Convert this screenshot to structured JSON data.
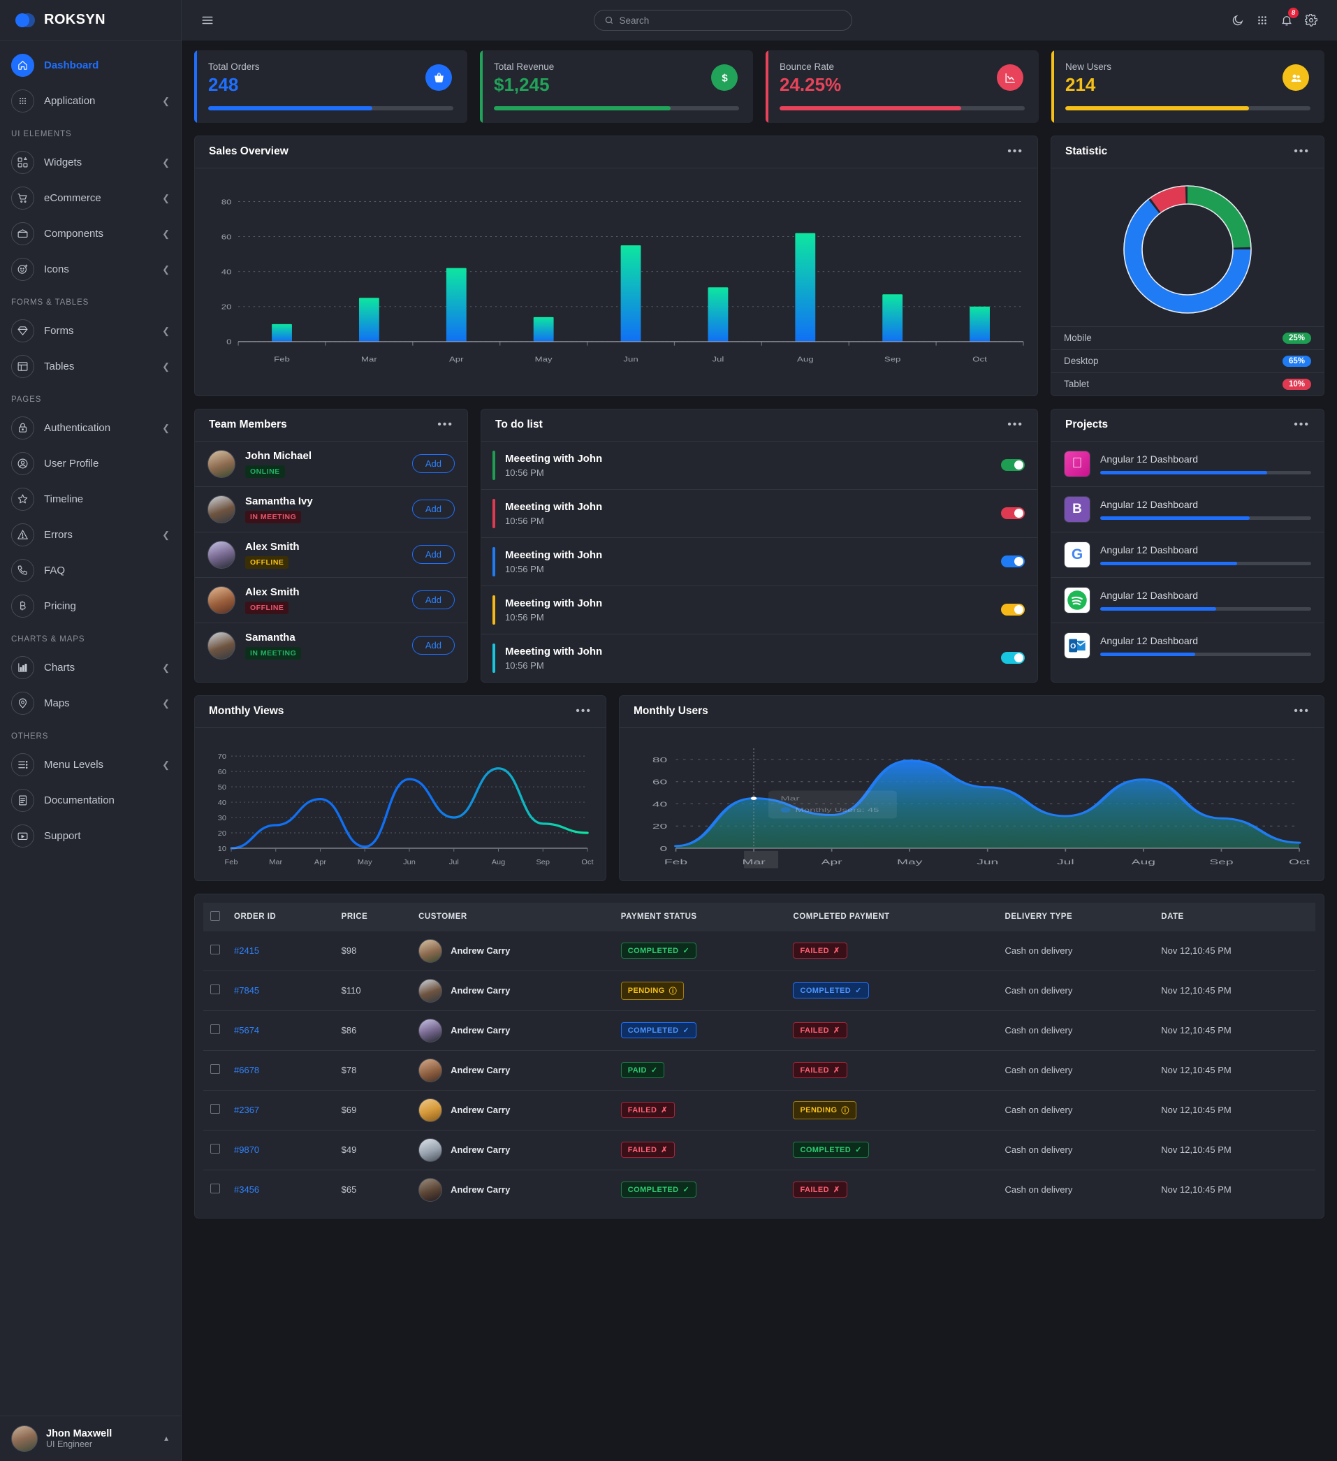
{
  "brand": {
    "name": "ROKSYN"
  },
  "topbar": {
    "menu_icon": "hamburger-icon",
    "search_placeholder": "Search",
    "search_value": "",
    "dark_mode_icon": "moon-icon",
    "apps_icon": "grid-apps-icon",
    "notifications_icon": "bell-icon",
    "notifications_count": "8",
    "settings_icon": "gear-icon"
  },
  "sidebar": {
    "groups": [
      {
        "label": "",
        "items": [
          {
            "label": "Dashboard",
            "icon": "home-icon",
            "active": true,
            "chevron": false
          },
          {
            "label": "Application",
            "icon": "grid-dots-icon",
            "active": false,
            "chevron": true
          }
        ]
      },
      {
        "label": "UI ELEMENTS",
        "items": [
          {
            "label": "Widgets",
            "icon": "widgets-icon",
            "active": false,
            "chevron": true
          },
          {
            "label": "eCommerce",
            "icon": "cart-icon",
            "active": false,
            "chevron": true
          },
          {
            "label": "Components",
            "icon": "components-icon",
            "active": false,
            "chevron": true
          },
          {
            "label": "Icons",
            "icon": "smiley-plus-icon",
            "active": false,
            "chevron": true
          }
        ]
      },
      {
        "label": "FORMS & TABLES",
        "items": [
          {
            "label": "Forms",
            "icon": "diamond-icon",
            "active": false,
            "chevron": true
          },
          {
            "label": "Tables",
            "icon": "table-icon",
            "active": false,
            "chevron": true
          }
        ]
      },
      {
        "label": "PAGES",
        "items": [
          {
            "label": "Authentication",
            "icon": "lock-icon",
            "active": false,
            "chevron": true
          },
          {
            "label": "User Profile",
            "icon": "user-circle-icon",
            "active": false,
            "chevron": false
          },
          {
            "label": "Timeline",
            "icon": "star-icon",
            "active": false,
            "chevron": false
          },
          {
            "label": "Errors",
            "icon": "warning-triangle-icon",
            "active": false,
            "chevron": true
          },
          {
            "label": "FAQ",
            "icon": "phone-icon",
            "active": false,
            "chevron": false
          },
          {
            "label": "Pricing",
            "icon": "bitcoin-icon",
            "active": false,
            "chevron": false
          }
        ]
      },
      {
        "label": "CHARTS & MAPS",
        "items": [
          {
            "label": "Charts",
            "icon": "chart-bars-icon",
            "active": false,
            "chevron": true
          },
          {
            "label": "Maps",
            "icon": "map-pin-icon",
            "active": false,
            "chevron": true
          }
        ]
      },
      {
        "label": "OTHERS",
        "items": [
          {
            "label": "Menu Levels",
            "icon": "list-icon",
            "active": false,
            "chevron": true
          },
          {
            "label": "Documentation",
            "icon": "document-icon",
            "active": false,
            "chevron": false
          },
          {
            "label": "Support",
            "icon": "support-icon",
            "active": false,
            "chevron": false
          }
        ]
      }
    ],
    "user": {
      "name": "Jhon Maxwell",
      "role": "UI Engineer",
      "caret": "caret-up-icon"
    }
  },
  "stats": [
    {
      "label": "Total Orders",
      "value": "248",
      "color": "#1f6fff",
      "icon": "basket-icon",
      "progress": 67
    },
    {
      "label": "Total Revenue",
      "value": "$1,245",
      "color": "#22a35a",
      "icon": "dollar-icon",
      "progress": 72
    },
    {
      "label": "Bounce Rate",
      "value": "24.25%",
      "color": "#e8435a",
      "icon": "chart-down-icon",
      "progress": 74
    },
    {
      "label": "New Users",
      "value": "214",
      "color": "#f5c018",
      "icon": "users-icon",
      "progress": 75
    }
  ],
  "panels": {
    "sales_title": "Sales Overview",
    "statistic_title": "Statistic",
    "team_title": "Team Members",
    "todo_title": "To do list",
    "projects_title": "Projects",
    "monthly_views_title": "Monthly Views",
    "monthly_users_title": "Monthly Users",
    "menu_dots": "•••"
  },
  "chart_data": [
    {
      "type": "bar",
      "title": "Sales Overview",
      "categories": [
        "Feb",
        "Mar",
        "Apr",
        "May",
        "Jun",
        "Jul",
        "Aug",
        "Sep",
        "Oct"
      ],
      "values": [
        10,
        25,
        42,
        14,
        55,
        31,
        62,
        27,
        20
      ],
      "ylim": [
        0,
        88
      ],
      "yticks": [
        0,
        20,
        40,
        60,
        80
      ],
      "xlabel": "",
      "ylabel": "",
      "grid": true,
      "legend": false,
      "bar_gradient": [
        "#0ee6a0",
        "#1070f5"
      ]
    },
    {
      "type": "pie",
      "title": "Statistic",
      "labels": [
        "Mobile",
        "Desktop",
        "Tablet"
      ],
      "values": [
        25,
        65,
        10
      ],
      "colors": [
        "#1e9e52",
        "#1f7cf5",
        "#e03a52"
      ],
      "legend": "bottom-list",
      "donut": true
    },
    {
      "type": "line",
      "title": "Monthly Views",
      "categories": [
        "Feb",
        "Mar",
        "Apr",
        "May",
        "Jun",
        "Jul",
        "Aug",
        "Sep",
        "Oct"
      ],
      "values": [
        10,
        25,
        42,
        11,
        55,
        30,
        62,
        26,
        20
      ],
      "ylim": [
        10,
        75
      ],
      "yticks": [
        10,
        20,
        30,
        40,
        50,
        60,
        70
      ],
      "grid": true,
      "legend": false,
      "line_gradient": [
        "#1070f5",
        "#0ee6a0"
      ]
    },
    {
      "type": "area",
      "title": "Monthly Users",
      "categories": [
        "Feb",
        "Mar",
        "Apr",
        "May",
        "Jun",
        "Jul",
        "Aug",
        "Sep",
        "Oct"
      ],
      "values": [
        2,
        45,
        30,
        79,
        55,
        29,
        62,
        27,
        5
      ],
      "ylim": [
        0,
        90
      ],
      "yticks": [
        0,
        20,
        40,
        60,
        80
      ],
      "grid": true,
      "legend": false,
      "tooltip": {
        "x_label": "Mar",
        "series_label": "Monthly Users",
        "value": "45"
      },
      "line_color": "#1f7cf5"
    }
  ],
  "statistic_rows": [
    {
      "label": "Mobile",
      "percent": "25%",
      "color": "#1e9e52"
    },
    {
      "label": "Desktop",
      "percent": "65%",
      "color": "#1f7cf5"
    },
    {
      "label": "Tablet",
      "percent": "10%",
      "color": "#e03a52"
    }
  ],
  "team_members": [
    {
      "name": "John Michael",
      "status": "ONLINE",
      "status_class": "b-online",
      "avatar": "a1",
      "action": "Add"
    },
    {
      "name": "Samantha Ivy",
      "status": "IN MEETING",
      "status_class": "b-meetred",
      "avatar": "a2",
      "action": "Add"
    },
    {
      "name": "Alex Smith",
      "status": "OFFLINE",
      "status_class": "b-offyel",
      "avatar": "a3",
      "action": "Add"
    },
    {
      "name": "Alex Smith",
      "status": "OFFLINE",
      "status_class": "b-offred",
      "avatar": "a4",
      "action": "Add"
    },
    {
      "name": "Samantha",
      "status": "IN MEETING",
      "status_class": "b-meetgrn",
      "avatar": "a5",
      "action": "Add"
    }
  ],
  "todo_items": [
    {
      "title": "Meeeting with John",
      "time": "10:56 PM",
      "color": "#1e9e52",
      "on": true
    },
    {
      "title": "Meeeting with John",
      "time": "10:56 PM",
      "color": "#e03a52",
      "on": true
    },
    {
      "title": "Meeeting with John",
      "time": "10:56 PM",
      "color": "#1f7cf5",
      "on": true
    },
    {
      "title": "Meeeting with John",
      "time": "10:56 PM",
      "color": "#f5b818",
      "on": true
    },
    {
      "title": "Meeeting with John",
      "time": "10:56 PM",
      "color": "#18c6e0",
      "on": true
    }
  ],
  "projects": [
    {
      "name": "Angular 12 Dashboard",
      "icon": "apple-icon",
      "progress": 79
    },
    {
      "name": "Angular 12 Dashboard",
      "icon": "bootstrap-icon",
      "progress": 71
    },
    {
      "name": "Angular 12 Dashboard",
      "icon": "google-icon",
      "progress": 65
    },
    {
      "name": "Angular 12 Dashboard",
      "icon": "spotify-icon",
      "progress": 55
    },
    {
      "name": "Angular 12 Dashboard",
      "icon": "outlook-icon",
      "progress": 45
    }
  ],
  "orders_table": {
    "columns": [
      "",
      "ORDER ID",
      "PRICE",
      "CUSTOMER",
      "PAYMENT STATUS",
      "COMPLETED PAYMENT",
      "DELIVERY TYPE",
      "DATE"
    ],
    "rows": [
      {
        "order_id": "#2415",
        "price": "$98",
        "customer": "Andrew Carry",
        "avatar": "a1",
        "payment_status": "COMPLETED",
        "payment_class": "tg-green",
        "payment_glyph": "✓",
        "completed_payment": "FAILED",
        "completed_class": "tg-red",
        "completed_glyph": "✗",
        "delivery_type": "Cash on delivery",
        "date": "Nov 12,10:45 PM"
      },
      {
        "order_id": "#7845",
        "price": "$110",
        "customer": "Andrew Carry",
        "avatar": "a2",
        "payment_status": "PENDING",
        "payment_class": "tg-yellow",
        "payment_glyph": "ⓘ",
        "completed_payment": "COMPLETED",
        "completed_class": "tg-blue",
        "completed_glyph": "✓",
        "delivery_type": "Cash on delivery",
        "date": "Nov 12,10:45 PM"
      },
      {
        "order_id": "#5674",
        "price": "$86",
        "customer": "Andrew Carry",
        "avatar": "a3",
        "payment_status": "COMPLETED",
        "payment_class": "tg-blue",
        "payment_glyph": "✓",
        "completed_payment": "FAILED",
        "completed_class": "tg-red",
        "completed_glyph": "✗",
        "delivery_type": "Cash on delivery",
        "date": "Nov 12,10:45 PM"
      },
      {
        "order_id": "#6678",
        "price": "$78",
        "customer": "Andrew Carry",
        "avatar": "a6",
        "payment_status": "PAID",
        "payment_class": "tg-green",
        "payment_glyph": "✓",
        "completed_payment": "FAILED",
        "completed_class": "tg-red",
        "completed_glyph": "✗",
        "delivery_type": "Cash on delivery",
        "date": "Nov 12,10:45 PM"
      },
      {
        "order_id": "#2367",
        "price": "$69",
        "customer": "Andrew Carry",
        "avatar": "a8",
        "payment_status": "FAILED",
        "payment_class": "tg-red",
        "payment_glyph": "✗",
        "completed_payment": "PENDING",
        "completed_class": "tg-yellow",
        "completed_glyph": "ⓘ",
        "delivery_type": "Cash on delivery",
        "date": "Nov 12,10:45 PM"
      },
      {
        "order_id": "#9870",
        "price": "$49",
        "customer": "Andrew Carry",
        "avatar": "a9",
        "payment_status": "FAILED",
        "payment_class": "tg-red",
        "payment_glyph": "✗",
        "completed_payment": "COMPLETED",
        "completed_class": "tg-green",
        "completed_glyph": "✓",
        "delivery_type": "Cash on delivery",
        "date": "Nov 12,10:45 PM"
      },
      {
        "order_id": "#3456",
        "price": "$65",
        "customer": "Andrew Carry",
        "avatar": "a10",
        "payment_status": "COMPLETED",
        "payment_class": "tg-green",
        "payment_glyph": "✓",
        "completed_payment": "FAILED",
        "completed_class": "tg-red",
        "completed_glyph": "✗",
        "delivery_type": "Cash on delivery",
        "date": "Nov 12,10:45 PM"
      }
    ]
  }
}
